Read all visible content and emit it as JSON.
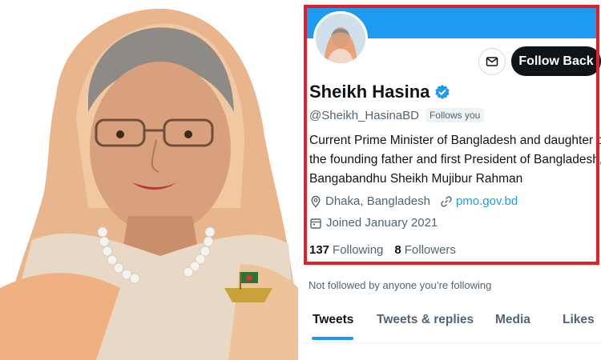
{
  "profile": {
    "name": "Sheikh Hasina",
    "handle": "@Sheikh_HasinaBD",
    "follows_you_badge": "Follows you",
    "bio_lines": [
      "Current Prime Minister of Bangladesh and daughter of",
      "the founding father and first President of Bangladesh,",
      "Bangabandhu Sheikh Mujibur Rahman"
    ],
    "location": "Dhaka, Bangladesh",
    "website": "pmo.gov.bd",
    "joined": "Joined January 2021",
    "following_count": "137",
    "following_label": "Following",
    "followers_count": "8",
    "followers_label": "Followers",
    "not_followed_note": "Not followed by anyone you’re following"
  },
  "actions": {
    "follow_back_label": "Follow Back",
    "message_icon": "envelope-icon"
  },
  "tabs": [
    {
      "label": "Tweets",
      "active": true
    },
    {
      "label": "Tweets & replies",
      "active": false
    },
    {
      "label": "Media",
      "active": false
    },
    {
      "label": "Likes",
      "active": false
    }
  ],
  "icons": {
    "verified": "verified-badge-icon",
    "location": "location-pin-icon",
    "link": "link-icon",
    "calendar": "calendar-icon"
  },
  "colors": {
    "highlight_frame": "#e41e26",
    "banner": "#1d9bf0",
    "follow_button": "#0f1419",
    "link": "#1d9bf0",
    "verified": "#1d9bf0"
  }
}
